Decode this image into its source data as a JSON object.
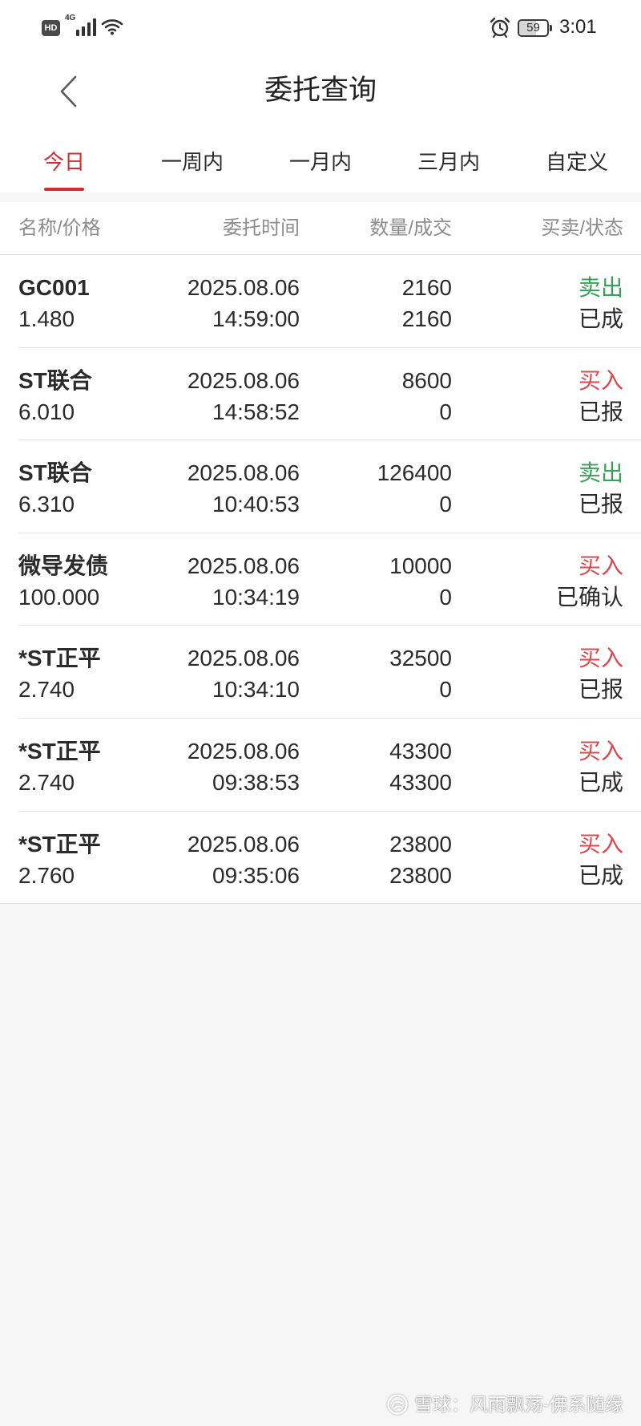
{
  "status_bar": {
    "hd": "HD",
    "network": "4G",
    "battery": "59",
    "time": "3:01",
    "icons": [
      "hd-badge",
      "signal-icon",
      "wifi-icon",
      "alarm-icon",
      "battery-icon"
    ]
  },
  "header": {
    "title": "委托查询",
    "back_icon": "back-chevron-icon"
  },
  "tabs": [
    {
      "label": "今日",
      "active": true
    },
    {
      "label": "一周内",
      "active": false
    },
    {
      "label": "一月内",
      "active": false
    },
    {
      "label": "三月内",
      "active": false
    },
    {
      "label": "自定义",
      "active": false
    }
  ],
  "columns": {
    "name_price": "名称/价格",
    "order_time": "委托时间",
    "quantity_filled": "数量/成交",
    "side_status": "买卖/状态"
  },
  "orders": [
    {
      "name": "GC001",
      "price": "1.480",
      "date": "2025.08.06",
      "time": "14:59:00",
      "quantity": "2160",
      "filled": "2160",
      "side": "卖出",
      "side_color": "#3a9f59",
      "status": "已成"
    },
    {
      "name": "ST联合",
      "price": "6.010",
      "date": "2025.08.06",
      "time": "14:58:52",
      "quantity": "8600",
      "filled": "0",
      "side": "买入",
      "side_color": "#d84a4f",
      "status": "已报"
    },
    {
      "name": "ST联合",
      "price": "6.310",
      "date": "2025.08.06",
      "time": "10:40:53",
      "quantity": "126400",
      "filled": "0",
      "side": "卖出",
      "side_color": "#3a9f59",
      "status": "已报"
    },
    {
      "name": "微导发债",
      "price": "100.000",
      "date": "2025.08.06",
      "time": "10:34:19",
      "quantity": "10000",
      "filled": "0",
      "side": "买入",
      "side_color": "#d84a4f",
      "status": "已确认"
    },
    {
      "name": "*ST正平",
      "price": "2.740",
      "date": "2025.08.06",
      "time": "10:34:10",
      "quantity": "32500",
      "filled": "0",
      "side": "买入",
      "side_color": "#d84a4f",
      "status": "已报"
    },
    {
      "name": "*ST正平",
      "price": "2.740",
      "date": "2025.08.06",
      "time": "09:38:53",
      "quantity": "43300",
      "filled": "43300",
      "side": "买入",
      "side_color": "#d84a4f",
      "status": "已成"
    },
    {
      "name": "*ST正平",
      "price": "2.760",
      "date": "2025.08.06",
      "time": "09:35:06",
      "quantity": "23800",
      "filled": "23800",
      "side": "买入",
      "side_color": "#d84a4f",
      "status": "已成"
    }
  ],
  "colors": {
    "accent": "#cf2f33",
    "buy": "#d84a4f",
    "sell": "#3a9f59",
    "text": "#2b2b2b",
    "muted": "#8c8c8c",
    "divider": "#e3e3e3",
    "background": "#f6f6f6"
  },
  "watermark": {
    "logo_icon": "xueqiu-logo-icon",
    "text": "雪球：风雨飘荡-佛系随缘"
  }
}
